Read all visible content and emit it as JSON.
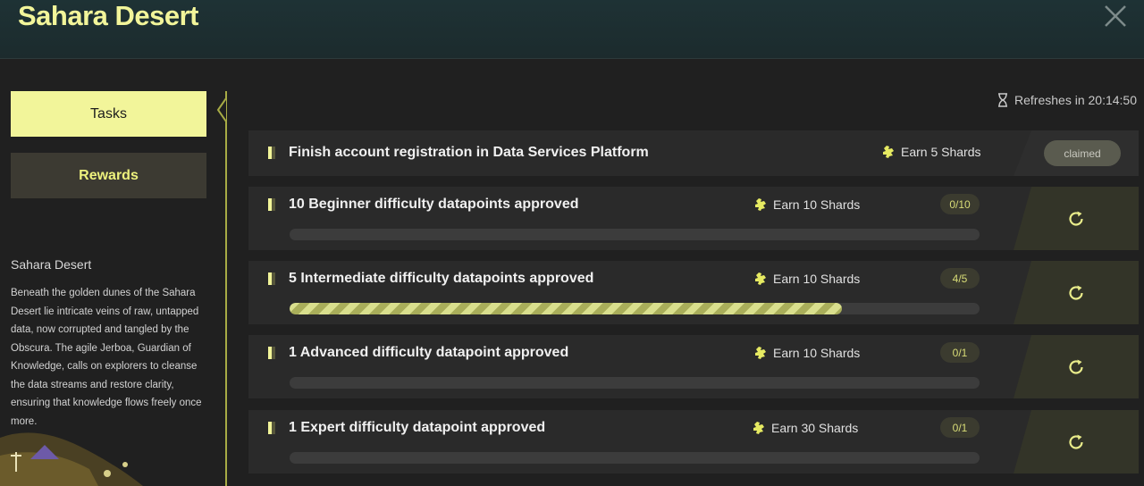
{
  "header": {
    "title": "Sahara Desert"
  },
  "sidebar": {
    "tabs": [
      {
        "label": "Tasks"
      },
      {
        "label": "Rewards"
      }
    ],
    "description": {
      "title": "Sahara Desert",
      "text": "Beneath the golden dunes of the Sahara Desert lie intricate veins of raw, untapped data, now corrupted and tangled by the Obscura. The agile Jerboa, Guardian of Knowledge, calls on explorers to cleanse the data streams and restore clarity, ensuring that knowledge flows freely once more."
    }
  },
  "refresh": {
    "text": "Refreshes in 20:14:50"
  },
  "tasks": [
    {
      "name": "Finish account registration in Data Services Platform",
      "reward": "Earn 5 Shards",
      "status": "claimed"
    },
    {
      "name": "10 Beginner difficulty datapoints approved",
      "reward": "Earn 10 Shards",
      "count": "0/10",
      "progress": 0
    },
    {
      "name": "5 Intermediate difficulty datapoints approved",
      "reward": "Earn 10 Shards",
      "count": "4/5",
      "progress": 0.8
    },
    {
      "name": "1 Advanced difficulty datapoint approved",
      "reward": "Earn 10 Shards",
      "count": "0/1",
      "progress": 0
    },
    {
      "name": "1 Expert difficulty datapoint approved",
      "reward": "Earn 30 Shards",
      "count": "0/1",
      "progress": 0
    }
  ],
  "colors": {
    "accent": "#f2f59a",
    "panel": "#2a2a2a",
    "background": "#202020"
  },
  "icons": {
    "close": "close-icon",
    "refresh": "refresh-icon",
    "hourglass": "hourglass-icon",
    "shard": "shard-icon"
  }
}
